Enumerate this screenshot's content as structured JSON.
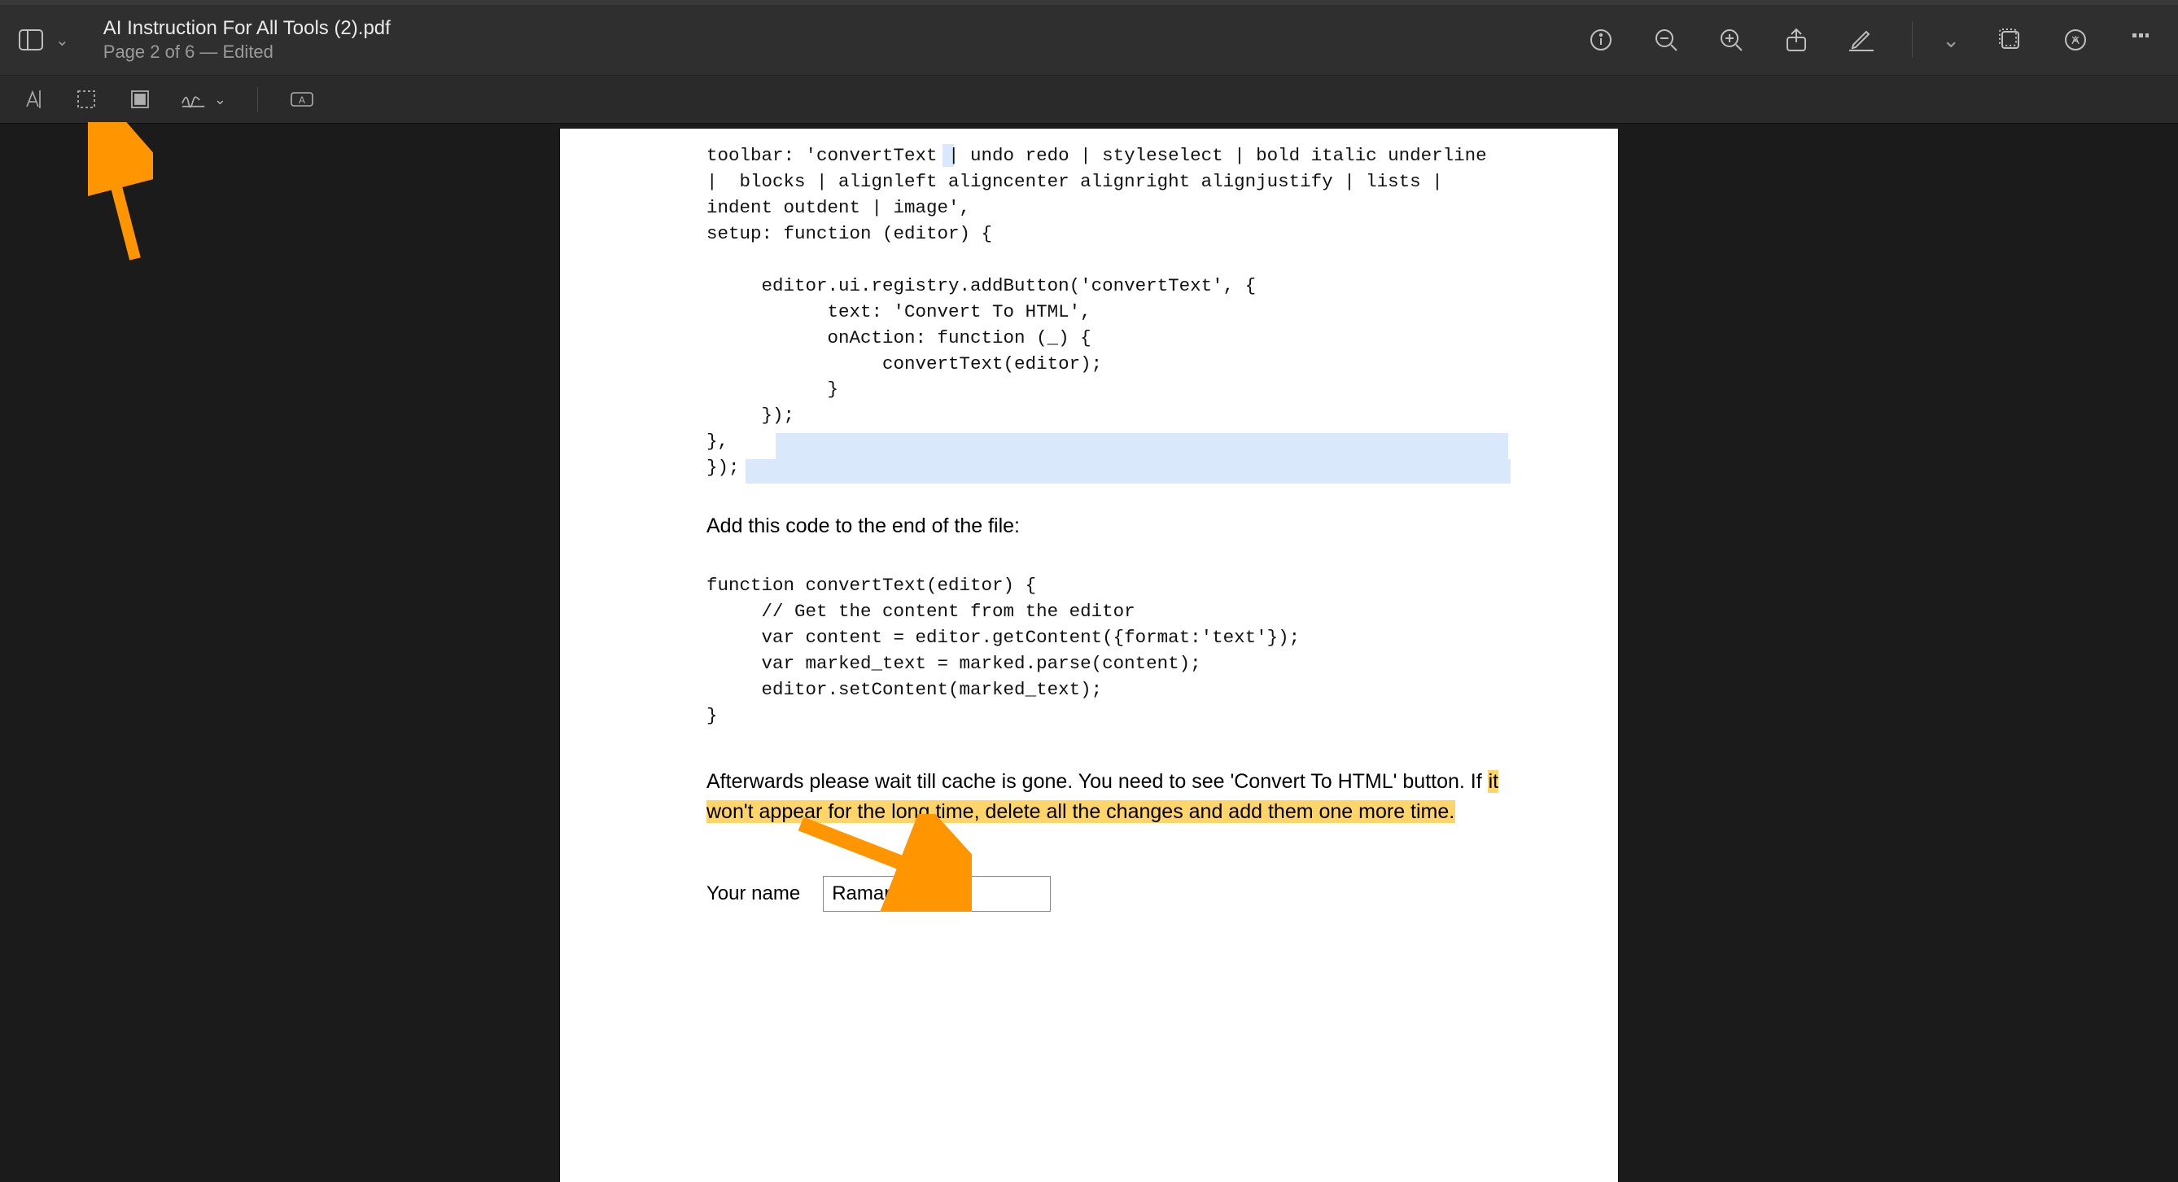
{
  "header": {
    "title": "AI Instruction For All Tools (2).pdf",
    "subtitle": "Page 2 of 6 — Edited"
  },
  "toolbar_icons": {
    "sidebar": "sidebar-icon",
    "dropdown": "chevron-down-icon",
    "info": "info-icon",
    "zoom_out": "zoom-out-icon",
    "zoom_in": "zoom-in-icon",
    "share": "share-icon",
    "markup": "pencil-icon",
    "markup_menu": "chevron-down-icon",
    "rotate": "rotate-icon",
    "search": "search-icon",
    "more": "more-icon"
  },
  "markup_icons": {
    "text_cursor": "text-cursor-icon",
    "select_rect": "selection-icon",
    "redact": "redact-icon",
    "sign": "signature-icon",
    "sign_menu": "chevron-down-icon",
    "form_field": "form-field-icon"
  },
  "doc": {
    "code1": "toolbar: 'convertText | undo redo | styleselect | bold italic underline\n|  blocks | alignleft aligncenter alignright alignjustify | lists |\nindent outdent | image',\nsetup: function (editor) {\n\n     editor.ui.registry.addButton('convertText', {\n           text: 'Convert To HTML',\n           onAction: function (_) {\n                convertText(editor);\n           }\n     });\n},\n});",
    "para1": "Add this code to the end of the file:",
    "code2": "function convertText(editor) {\n     // Get the content from the editor\n     var content = editor.getContent({format:'text'});\n     var marked_text = marked.parse(content);\n     editor.setContent(marked_text);\n}",
    "para2_prefix": "Afterwards please wait till cache is gone. You need to see  'Convert To HTML' button. If ",
    "para2_hl": "it won't appear for the long time, delete all the changes and add them one more time.",
    "form_label": "Your name",
    "form_value": "Raman"
  },
  "colors": {
    "arrow": "#ff9500",
    "highlight": "#ffd469",
    "selection": "#d9e8fb"
  }
}
